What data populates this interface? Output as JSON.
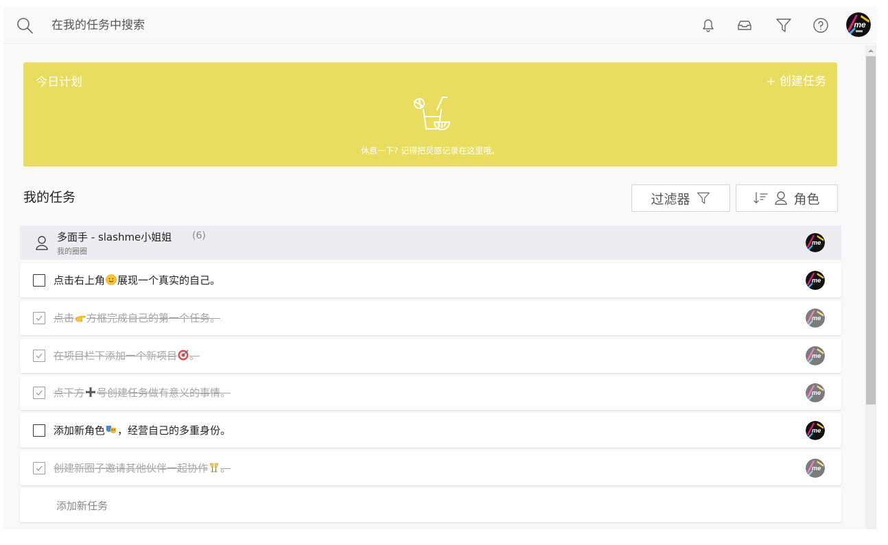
{
  "header": {
    "search_placeholder": "在我的任务中搜索",
    "icons": [
      "search-icon",
      "bell-icon",
      "inbox-icon",
      "filter-icon",
      "help-icon"
    ]
  },
  "plan": {
    "title": "今日计划",
    "create_label": "+ 创建任务",
    "hint": "休息一下? 记得把灵感记录在这里哦。",
    "color": "#e8dd5f"
  },
  "section": {
    "title": "我的任务",
    "filter_label": "过滤器",
    "sort_label": "角色"
  },
  "group": {
    "title": "多面手 - slashme小姐姐",
    "count": "(6)",
    "subtitle": "我的圈圈"
  },
  "tasks": [
    {
      "pre": "点击右上角",
      "emoji": "smile-emoji-icon",
      "post": "展现一个真实的自己。",
      "done": false
    },
    {
      "pre": "点击",
      "emoji": "pointing-hand-emoji-icon",
      "post": "方框完成自己的第一个任务。",
      "done": true
    },
    {
      "pre": "在项目栏下添加一个新项目",
      "emoji": "target-emoji-icon",
      "post": "。",
      "done": true
    },
    {
      "pre": "点下方",
      "emoji": "plus-emoji-icon",
      "post": "号创建任务做有意义的事情。",
      "done": true
    },
    {
      "pre": "添加新角色",
      "emoji": "masks-emoji-icon",
      "post": "，经营自己的多重身份。",
      "done": false
    },
    {
      "pre": "创建新圈子邀请其他伙伴一起协作",
      "emoji": "toast-emoji-icon",
      "post": "。",
      "done": true
    }
  ],
  "add_task_label": "添加新任务"
}
